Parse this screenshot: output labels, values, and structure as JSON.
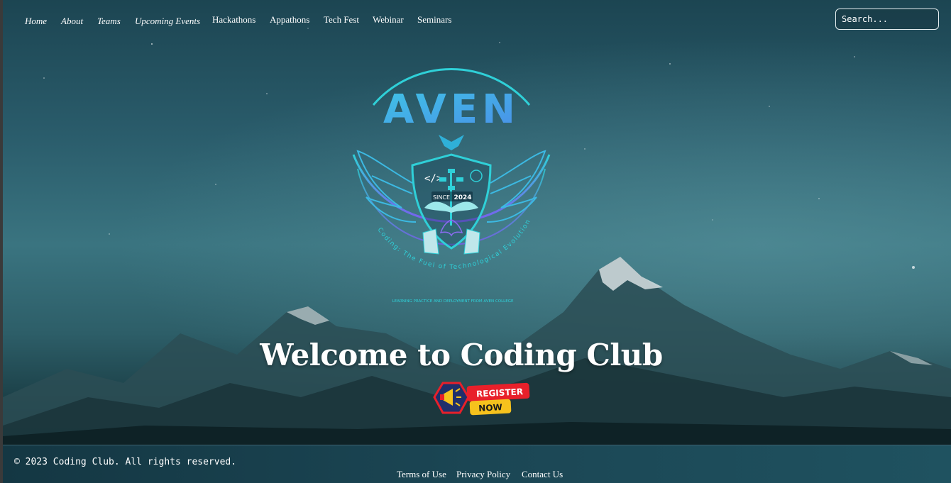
{
  "nav": {
    "items": [
      {
        "label": "Home"
      },
      {
        "label": "About"
      },
      {
        "label": "Teams"
      },
      {
        "label": "Upcoming Events"
      },
      {
        "label": "Hackathons"
      },
      {
        "label": "Appathons"
      },
      {
        "label": "Tech Fest"
      },
      {
        "label": "Webinar"
      },
      {
        "label": "Seminars"
      }
    ]
  },
  "search": {
    "placeholder": "Search...",
    "value": ""
  },
  "logo": {
    "wordmark": "AVEN",
    "since": "SINCE",
    "year": "2024",
    "tagline": "Coding: The Fuel of Technological Evolution",
    "subline": "LEARNING PRACTICE AND DEPLOYMENT FROM AVEN COLLEGE"
  },
  "hero": {
    "title": "Welcome to Coding Club"
  },
  "register": {
    "line1": "REGISTER",
    "line2": "NOW"
  },
  "footer": {
    "copyright": "© 2023 Coding Club. All rights reserved.",
    "links": [
      {
        "label": "Terms of Use"
      },
      {
        "label": "Privacy Policy"
      },
      {
        "label": "Contact Us"
      }
    ]
  },
  "colors": {
    "logo_cyan": "#2fd0d8",
    "logo_purple": "#7a5cf0",
    "register_red": "#e8202a",
    "register_yellow": "#f6c21d",
    "footer_bg": "#1b4654"
  }
}
